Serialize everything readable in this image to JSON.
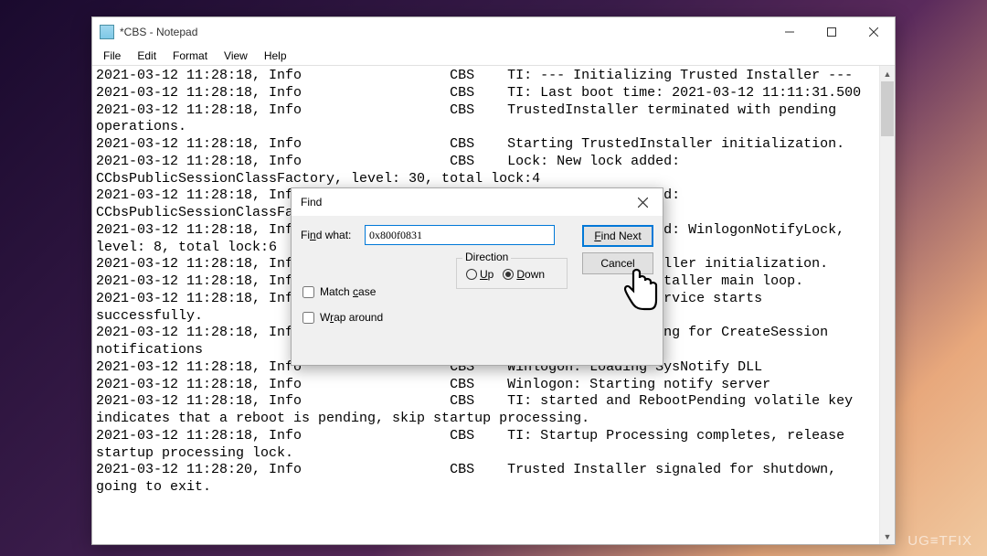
{
  "window": {
    "title": "*CBS - Notepad",
    "menus": [
      "File",
      "Edit",
      "Format",
      "View",
      "Help"
    ]
  },
  "content_lines": [
    "2021-03-12 11:28:18, Info                  CBS    TI: --- Initializing Trusted Installer ---",
    "2021-03-12 11:28:18, Info                  CBS    TI: Last boot time: 2021-03-12 11:11:31.500",
    "2021-03-12 11:28:18, Info                  CBS    TrustedInstaller terminated with pending",
    "operations.",
    "2021-03-12 11:28:18, Info                  CBS    Starting TrustedInstaller initialization.",
    "2021-03-12 11:28:18, Info                  CBS    Lock: New lock added:",
    "CCbsPublicSessionClassFactory, level: 30, total lock:4",
    "2021-03-12 11:28:18, Info                  CBS    Lock: New lock added:",
    "CCbsPublicSessionClassFactory, level: 30, total lock:5",
    "2021-03-12 11:28:18, Info                  CBS    Lock: New lock added: WinlogonNotifyLock,",
    "level: 8, total lock:6",
    "2021-03-12 11:28:18, Info                  CBS    Ending TrustedInstaller initialization.",
    "2021-03-12 11:28:18, Info                  CBS    Starting TrustedInstaller main loop.",
    "2021-03-12 11:28:18, Info                  CBS    TrustedInstaller service starts",
    "successfully.",
    "2021-03-12 11:28:18, Info                  CBS    Winlogon: Registering for CreateSession",
    "notifications",
    "2021-03-12 11:28:18, Info                  CBS    Winlogon: Loading SysNotify DLL",
    "2021-03-12 11:28:18, Info                  CBS    Winlogon: Starting notify server",
    "2021-03-12 11:28:18, Info                  CBS    TI: started and RebootPending volatile key",
    "indicates that a reboot is pending, skip startup processing.",
    "2021-03-12 11:28:18, Info                  CBS    TI: Startup Processing completes, release",
    "startup processing lock.",
    "2021-03-12 11:28:20, Info                  CBS    Trusted Installer signaled for shutdown,",
    "going to exit."
  ],
  "find_dialog": {
    "title": "Find",
    "find_what_label": "Find what:",
    "find_what_value": "0x800f0831",
    "find_next_label": "Find Next",
    "cancel_label": "Cancel",
    "match_case_label": "Match case",
    "wrap_around_label": "Wrap around",
    "direction_label": "Direction",
    "up_label": "Up",
    "down_label": "Down",
    "direction_selected": "Down"
  },
  "watermark": "UG≡TFIX"
}
